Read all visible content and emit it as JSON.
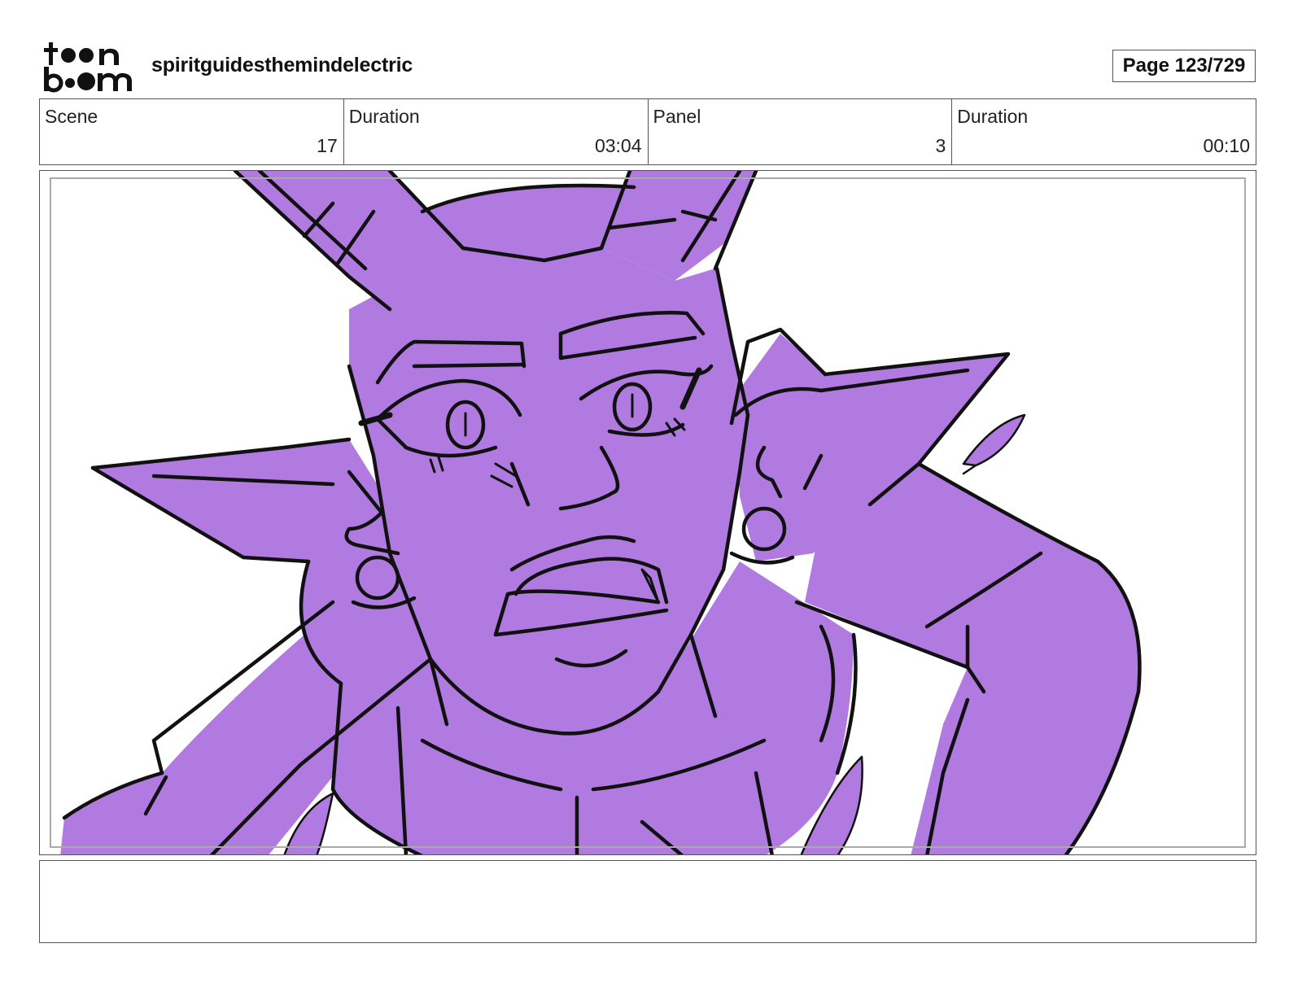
{
  "header": {
    "logo_text_top": "toon",
    "logo_text_bottom": "boom",
    "project_name": "spiritguidesthemindelectric",
    "page_indicator": "Page 123/729"
  },
  "info": {
    "scene_label": "Scene",
    "scene_value": "17",
    "scene_duration_label": "Duration",
    "scene_duration_value": "03:04",
    "panel_label": "Panel",
    "panel_value": "3",
    "panel_duration_label": "Duration",
    "panel_duration_value": "00:10"
  },
  "panel": {
    "fill_color": "#b07ae0",
    "line_color": "#111111"
  },
  "caption": {
    "text": ""
  }
}
